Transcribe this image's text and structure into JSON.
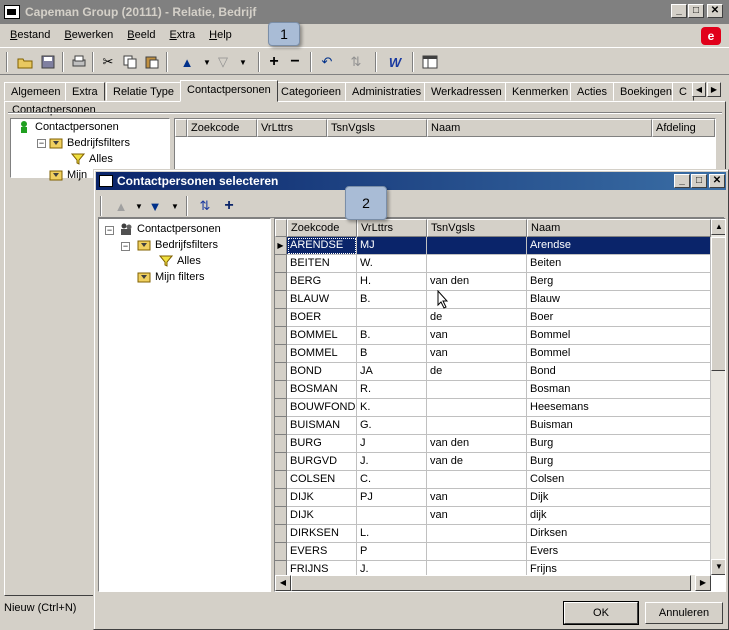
{
  "window": {
    "title": "Capeman Group (20111) - Relatie, Bedrijf"
  },
  "menu": [
    "Bestand",
    "Bewerken",
    "Beeld",
    "Extra",
    "Help"
  ],
  "callouts": [
    "1",
    "2"
  ],
  "tabs": [
    "Algemeen",
    "Extra",
    "Relatie Type",
    "Contactpersonen",
    "Categorieen",
    "Administraties",
    "Werkadressen",
    "Kenmerken",
    "Acties",
    "Boekingen",
    "C"
  ],
  "active_tab": "Contactpersonen",
  "panel": {
    "group_label": "Contactpersonen"
  },
  "main_tree": {
    "root": "Contactpersonen",
    "filters": "Bedrijfsfilters",
    "all": "Alles",
    "mine": "Mijn"
  },
  "main_grid": {
    "columns": [
      "Zoekcode",
      "VrLttrs",
      "TsnVgsls",
      "Naam",
      "Afdeling"
    ]
  },
  "status": {
    "text": "Nieuw (Ctrl+N)"
  },
  "dialog": {
    "title": "Contactpersonen selecteren",
    "tree": {
      "root": "Contactpersonen",
      "filters": "Bedrijfsfilters",
      "all": "Alles",
      "mine": "Mijn filters"
    },
    "grid": {
      "columns": [
        "Zoekcode",
        "VrLttrs",
        "TsnVgsls",
        "Naam"
      ],
      "rows": [
        [
          "ARENDSE",
          "MJ",
          "",
          "Arendse"
        ],
        [
          "BEITEN",
          "W.",
          "",
          "Beiten"
        ],
        [
          "BERG",
          "H.",
          "van den",
          "Berg"
        ],
        [
          "BLAUW",
          "B.",
          "",
          "Blauw"
        ],
        [
          "BOER",
          "",
          "de",
          "Boer"
        ],
        [
          "BOMMEL",
          "B.",
          "van",
          "Bommel"
        ],
        [
          "BOMMEL",
          "B",
          "van",
          "Bommel"
        ],
        [
          "BOND",
          "JA",
          "de",
          "Bond"
        ],
        [
          "BOSMAN",
          "R.",
          "",
          "Bosman"
        ],
        [
          "BOUWFONDS",
          "K.",
          "",
          "Heesemans"
        ],
        [
          "BUISMAN",
          "G.",
          "",
          "Buisman"
        ],
        [
          "BURG",
          "J",
          "van den",
          "Burg"
        ],
        [
          "BURGVD",
          "J.",
          "van de",
          "Burg"
        ],
        [
          "COLSEN",
          "C.",
          "",
          "Colsen"
        ],
        [
          "DIJK",
          "PJ",
          "van",
          "Dijk"
        ],
        [
          "DIJK",
          "",
          "van",
          "dijk"
        ],
        [
          "DIRKSEN",
          "L.",
          "",
          "Dirksen"
        ],
        [
          "EVERS",
          "P",
          "",
          "Evers"
        ],
        [
          "FRIJNS",
          "J.",
          "",
          "Frijns"
        ]
      ],
      "selected_row": 0
    },
    "ok_label": "OK",
    "cancel_label": "Annuleren"
  },
  "colors": {
    "selection": "#0a246a",
    "dialog_title": "#0a246a",
    "brand": "#e1001a",
    "callout": "#a9bcd6"
  }
}
